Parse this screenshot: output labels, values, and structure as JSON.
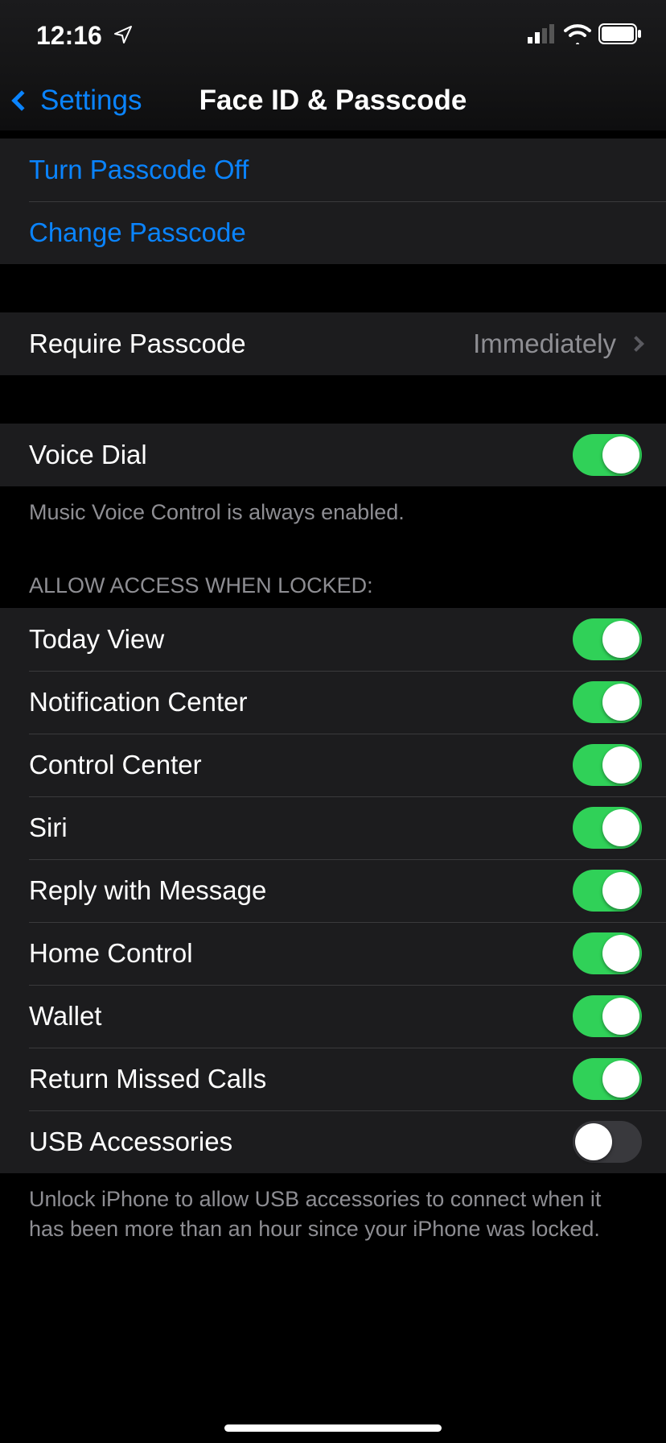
{
  "status": {
    "time": "12:16"
  },
  "nav": {
    "back": "Settings",
    "title": "Face ID & Passcode"
  },
  "passcode_actions": {
    "turn_off": "Turn Passcode Off",
    "change": "Change Passcode"
  },
  "require": {
    "label": "Require Passcode",
    "value": "Immediately"
  },
  "voice_dial": {
    "label": "Voice Dial",
    "on": true,
    "footer": "Music Voice Control is always enabled."
  },
  "allow_header": "Allow Access When Locked:",
  "allow": [
    {
      "label": "Today View",
      "on": true
    },
    {
      "label": "Notification Center",
      "on": true
    },
    {
      "label": "Control Center",
      "on": true
    },
    {
      "label": "Siri",
      "on": true
    },
    {
      "label": "Reply with Message",
      "on": true
    },
    {
      "label": "Home Control",
      "on": true
    },
    {
      "label": "Wallet",
      "on": true
    },
    {
      "label": "Return Missed Calls",
      "on": true
    },
    {
      "label": "USB Accessories",
      "on": false
    }
  ],
  "usb_footer": "Unlock iPhone to allow USB accessories to connect when it has been more than an hour since your iPhone was locked."
}
